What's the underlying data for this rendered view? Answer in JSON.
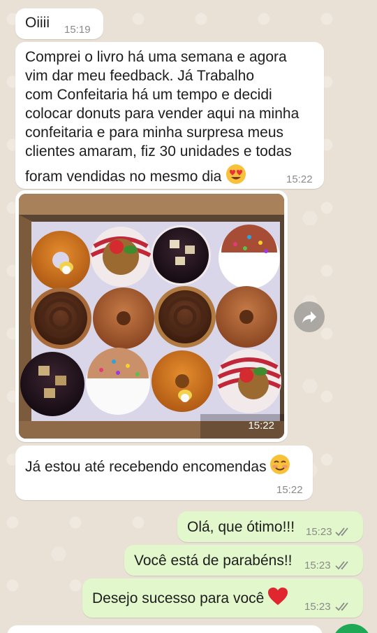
{
  "messages": [
    {
      "id": "m1",
      "direction": "in",
      "text": "Oiiii",
      "time": "15:19"
    },
    {
      "id": "m2",
      "direction": "in",
      "lines": [
        "Comprei o livro há uma semana e agora",
        "vim dar meu feedback. Já Trabalho",
        "com Confeitaria há um tempo e decidi",
        "colocar donuts para vender aqui na minha",
        "confeitaria e para minha surpresa meus",
        "clientes amaram, fiz 30 unidades e todas",
        "foram vendidas no mesmo dia"
      ],
      "emoji": "heart-eyes-emoji",
      "time": "15:22"
    },
    {
      "id": "m3",
      "direction": "in",
      "type": "image",
      "image_subject": "donut-box-photo",
      "time": "15:22"
    },
    {
      "id": "m4",
      "direction": "in",
      "text": "Já estou até recebendo encomendas",
      "emoji": "smiling-blush-emoji",
      "time": "15:22"
    },
    {
      "id": "m5",
      "direction": "out",
      "text": "Olá, que ótimo!!!",
      "time": "15:23",
      "status": "read"
    },
    {
      "id": "m6",
      "direction": "out",
      "text": "Você está de parabéns!!",
      "time": "15:23",
      "status": "read"
    },
    {
      "id": "m7",
      "direction": "out",
      "text": "Desejo sucesso para você",
      "emoji": "red-heart-emoji",
      "time": "15:23",
      "status": "read"
    }
  ],
  "colors": {
    "incoming_bubble": "#ffffff",
    "outgoing_bubble": "#e2f7cb",
    "wallpaper": "#e9e1d6",
    "tick_color": "#8a8a8a",
    "fab": "#1fa855"
  },
  "icons": [
    "forward-arrow-icon",
    "double-check-icon"
  ]
}
